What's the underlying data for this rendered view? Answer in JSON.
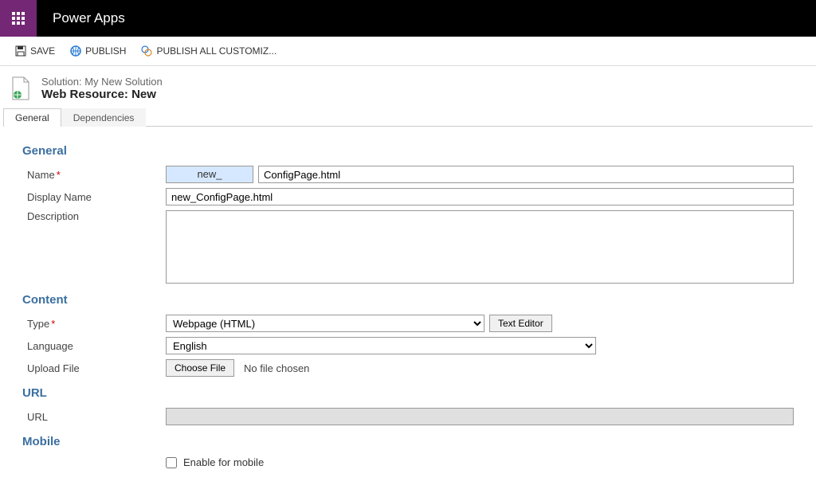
{
  "header": {
    "app_title": "Power Apps"
  },
  "toolbar": {
    "save": "SAVE",
    "publish": "PUBLISH",
    "publish_all": "PUBLISH ALL CUSTOMIZ..."
  },
  "page": {
    "solution_prefix": "Solution: ",
    "solution_name": "My New Solution",
    "entity_title": "Web Resource: New"
  },
  "tabs": {
    "general": "General",
    "dependencies": "Dependencies"
  },
  "general": {
    "section_title": "General",
    "name_label": "Name",
    "name_prefix": "new_",
    "name_value": "ConfigPage.html",
    "display_name_label": "Display Name",
    "display_name_value": "new_ConfigPage.html",
    "description_label": "Description",
    "description_value": ""
  },
  "content": {
    "section_title": "Content",
    "type_label": "Type",
    "type_value": "Webpage (HTML)",
    "text_editor_btn": "Text Editor",
    "language_label": "Language",
    "language_value": "English",
    "upload_label": "Upload File",
    "choose_file_btn": "Choose File",
    "no_file_text": "No file chosen"
  },
  "url": {
    "section_title": "URL",
    "url_label": "URL",
    "url_value": ""
  },
  "mobile": {
    "section_title": "Mobile",
    "enable_label": "Enable for mobile"
  }
}
